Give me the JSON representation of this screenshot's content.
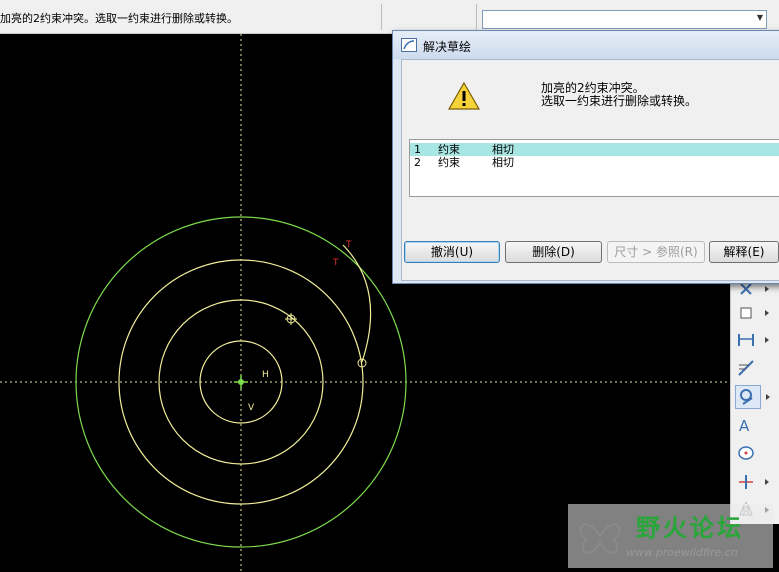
{
  "status_bar": {
    "message": "加亮的2约束冲突。选取一约束进行删除或转换。",
    "dropdown_value": ""
  },
  "canvas": {
    "background": "#000000",
    "labels": {
      "h": "H",
      "v": "V",
      "t1": "T",
      "t2": "T"
    }
  },
  "dialog": {
    "title": "解决草绘",
    "message_line1": "加亮的2约束冲突。",
    "message_line2": "选取一约束进行删除或转换。",
    "constraints": [
      {
        "index": "1",
        "type": "约束",
        "kind": "相切"
      },
      {
        "index": "2",
        "type": "约束",
        "kind": "相切"
      }
    ],
    "buttons": {
      "undo": "撤消(U)",
      "delete": "删除(D)",
      "dim_ref": "尺寸 > 参照(R)",
      "explain": "解释(E)"
    }
  },
  "toolbar": {
    "tools": [
      "point-tool-icon",
      "rectangle-tool-icon",
      "dimension-tool-icon",
      "modify-tool-icon",
      "constraint-tool-icon",
      "text-tool-icon",
      "palette-tool-icon",
      "trim-tool-icon",
      "mirror-tool-icon"
    ]
  },
  "watermark": {
    "title": "野火论坛",
    "url": "www.proewildfire.cn"
  },
  "colors": {
    "outer_circle": "#7ddc4c",
    "inner_circles": "#f2ef9a",
    "selected_row": "#a8e6e3",
    "constraint_marker": "#e03030"
  }
}
